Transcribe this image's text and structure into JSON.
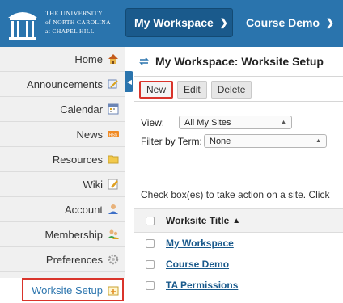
{
  "header": {
    "university": [
      "THE UNIVERSITY",
      "of NORTH CAROLINA",
      "at CHAPEL HILL"
    ],
    "workspace_label": "My Workspace",
    "course_label": "Course Demo"
  },
  "sidebar": {
    "items": [
      {
        "label": "Home",
        "icon": "home-icon"
      },
      {
        "label": "Announcements",
        "icon": "megaphone-icon"
      },
      {
        "label": "Calendar",
        "icon": "calendar-icon"
      },
      {
        "label": "News",
        "icon": "rss-icon"
      },
      {
        "label": "Resources",
        "icon": "folder-icon"
      },
      {
        "label": "Wiki",
        "icon": "pencil-icon"
      },
      {
        "label": "Account",
        "icon": "user-icon"
      },
      {
        "label": "Membership",
        "icon": "users-icon"
      },
      {
        "label": "Preferences",
        "icon": "gear-icon"
      },
      {
        "label": "Worksite Setup",
        "icon": "worksite-icon",
        "active": true
      }
    ]
  },
  "main": {
    "title": "My Workspace: Worksite Setup",
    "toolbar": {
      "new": "New",
      "edit": "Edit",
      "delete": "Delete"
    },
    "view_label": "View:",
    "view_value": "All My Sites",
    "term_label": "Filter by Term:",
    "term_value": "None",
    "instructions": "Check box(es) to take action on a site. Click",
    "table": {
      "header": "Worksite Title",
      "rows": [
        "My Workspace",
        "Course Demo",
        "TA Permissions"
      ]
    }
  },
  "colors": {
    "brand": "#2a74ad",
    "highlight": "#d9342b"
  }
}
